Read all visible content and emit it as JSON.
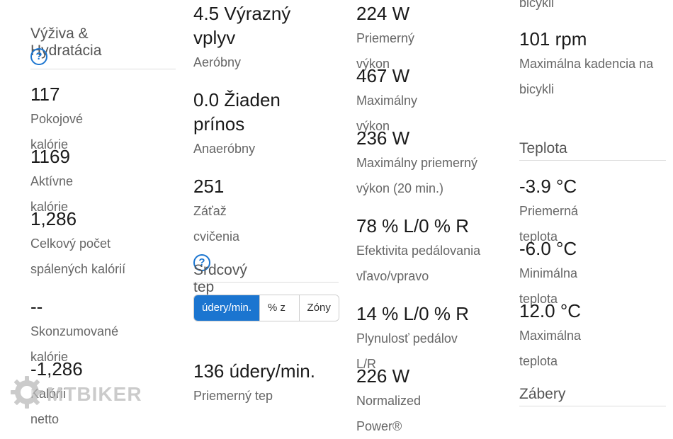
{
  "nutrition": {
    "title": "Výživa & Hydratácia",
    "help_icon": "?",
    "stats": [
      {
        "value": "117",
        "label": "Pokojové kalórie"
      },
      {
        "value": "1169",
        "label": "Aktívne kalórie"
      },
      {
        "value": "1,286",
        "label": "Celkový počet spálených kalórií"
      },
      {
        "value": "--",
        "label": "Skonzumované kalórie"
      },
      {
        "value": "-1,286",
        "label": "Kalórii netto"
      }
    ]
  },
  "training": {
    "aerobic": {
      "value": "4.5 Výrazný vplyv",
      "label": "Aeróbny"
    },
    "anaerobic": {
      "value": "0.0 Žiaden prínos",
      "label": "Anaeróbny"
    },
    "load": {
      "value": "251",
      "label": "Záťaž cvičenia",
      "help_icon": "?"
    }
  },
  "heart_rate": {
    "title": "Srdcový tep",
    "tabs": [
      {
        "label": "údery/min.",
        "active": true
      },
      {
        "label": "% z max.",
        "active": false
      },
      {
        "label": "Zóny",
        "active": false
      }
    ],
    "avg": {
      "value": "136 údery/min.",
      "label": "Priemerný tep"
    }
  },
  "power": {
    "stats": [
      {
        "value": "224 W",
        "label": "Priemerný výkon"
      },
      {
        "value": "467 W",
        "label": "Maximálny výkon"
      },
      {
        "value": "236 W",
        "label": "Maximálny priemerný výkon (20 min.)"
      },
      {
        "value": "78 % L/0 % R",
        "label": "Efektivita pedálovania vľavo/vpravo"
      },
      {
        "value": "14 % L/0 % R",
        "label": "Plynulosť pedálov L/R"
      },
      {
        "value": "226 W",
        "label": "Normalized Power®"
      }
    ]
  },
  "cadence": {
    "partial_label": "bicykli",
    "max": {
      "value": "101 rpm",
      "label": "Maximálna kadencia na bicykli"
    }
  },
  "temperature": {
    "title": "Teplota",
    "stats": [
      {
        "value": "-3.9 °C",
        "label": "Priemerná teplota"
      },
      {
        "value": "-6.0 °C",
        "label": "Minimálna teplota"
      },
      {
        "value": "12.0 °C",
        "label": "Maximálna teplota"
      }
    ]
  },
  "strokes": {
    "title": "Zábery"
  },
  "watermark": {
    "text": "MTBIKER",
    "icon": "gear-icon"
  },
  "colors": {
    "accent": "#1b75d0"
  }
}
